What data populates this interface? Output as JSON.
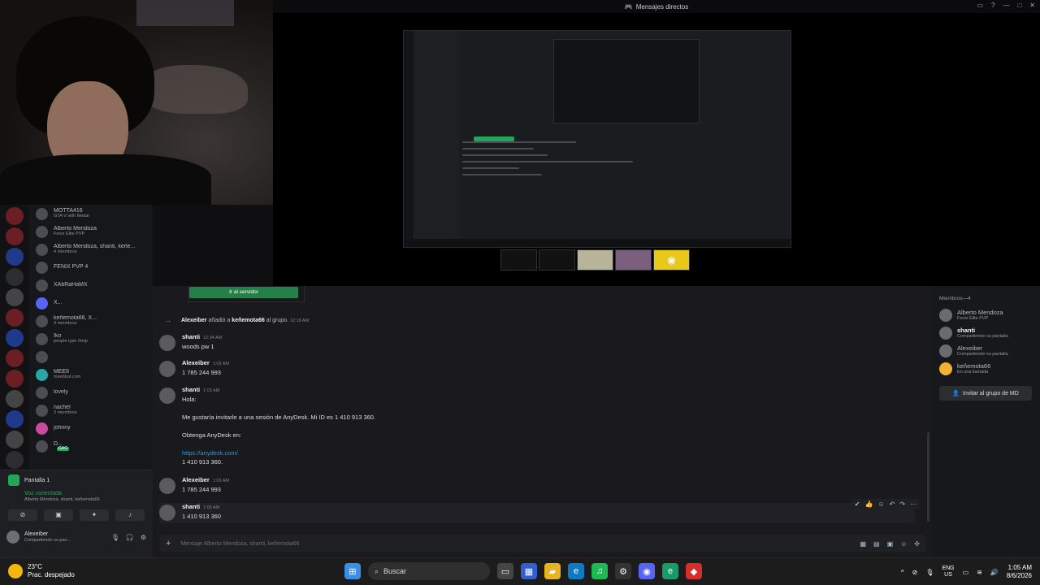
{
  "window": {
    "title": "Mensajes directos",
    "controls": [
      "▭",
      "?",
      "—",
      "□",
      "✕"
    ]
  },
  "invite_card": {
    "button": "Ir al servidor"
  },
  "dm_list": [
    {
      "name": "MOTTA416",
      "sub": "GTA V with Medal",
      "avatar": "gray"
    },
    {
      "name": "Alberto Mendoza",
      "sub": "Fenix Elite PVP",
      "avatar": "gray"
    },
    {
      "name": "Alberto Mendoza, shanti, keñe...",
      "sub": "4 miembros",
      "avatar": "gray"
    },
    {
      "name": "FENIX PVP 4",
      "sub": "",
      "avatar": "gray"
    },
    {
      "name": "XAbRaHaMX",
      "sub": "",
      "avatar": "gray"
    },
    {
      "name": "X...",
      "sub": "",
      "avatar": "discord"
    },
    {
      "name": "keñemota66, X...",
      "sub": "3 miembros",
      "avatar": "gray"
    },
    {
      "name": "Iko",
      "sub": "people type /help",
      "avatar": "gray"
    },
    {
      "name": "",
      "sub": "",
      "avatar": "gray"
    },
    {
      "name": "MEE6",
      "sub": "mee6bot.com",
      "avatar": "teal"
    },
    {
      "name": "lovely",
      "sub": "",
      "avatar": "gray"
    },
    {
      "name": "nachel",
      "sub": "3 miembros",
      "avatar": "gray"
    },
    {
      "name": "johnny",
      "sub": "",
      "avatar": "pink"
    },
    {
      "name": "D...",
      "sub": "",
      "avatar": "gray",
      "tag": "GAG"
    }
  ],
  "user_panel": {
    "screen_label": "Pantalla 1",
    "voice_status": "Voz conectada",
    "voice_members": "Alberto Mendoza, shanti, keñemota66",
    "username": "Alexeiber",
    "user_status": "Compartiendo su pan..."
  },
  "chat": {
    "system": {
      "actor": "Alexeiber",
      "action": "añadió a",
      "target": "keñemota66",
      "suffix": "al grupo.",
      "time": "12:18 AM"
    },
    "messages": [
      {
        "author": "shanti",
        "time": "12:34 AM",
        "lines": [
          "woods pw 1"
        ]
      },
      {
        "author": "Alexeiber",
        "time": "1:03 AM",
        "lines": [
          "1 785 244 993"
        ]
      },
      {
        "author": "shanti",
        "time": "1:03 AM",
        "lines": [
          "Hola:",
          "",
          "Me gustaría invitarle a una sesión de AnyDesk. Mi ID es 1 410 913 360.",
          "",
          "Obtenga AnyDesk en:",
          "",
          "https://anydesk.com/",
          "1 410 913 360."
        ]
      },
      {
        "author": "Alexeiber",
        "time": "1:03 AM",
        "lines": [
          "1 785 244 993"
        ]
      },
      {
        "author": "shanti",
        "time": "1:05 AM",
        "lines": [
          "1 410 913 360"
        ]
      }
    ],
    "composer_placeholder": "Mensaje Alberto Mendoza, shanti, keñemota66"
  },
  "members": {
    "header": "Miembros—4",
    "list": [
      {
        "name": "Alberto Mendoza",
        "status": "Fenix Elite PVP",
        "bold": false
      },
      {
        "name": "shanti",
        "status": "Compartiendo su pantalla",
        "bold": true
      },
      {
        "name": "Alexeiber",
        "status": "Compartiendo su pantalla",
        "bold": false
      },
      {
        "name": "keñemota66",
        "status": "En una llamada",
        "bold": false
      }
    ],
    "invite_button": "Invitar al grupo de MD"
  },
  "taskbar": {
    "weather_temp": "23°C",
    "weather_desc": "Prac. despejado",
    "search_label": "Buscar",
    "lang1": "ENG",
    "lang2": "US",
    "time": "1:05 AM",
    "date": "8/6/2026"
  }
}
